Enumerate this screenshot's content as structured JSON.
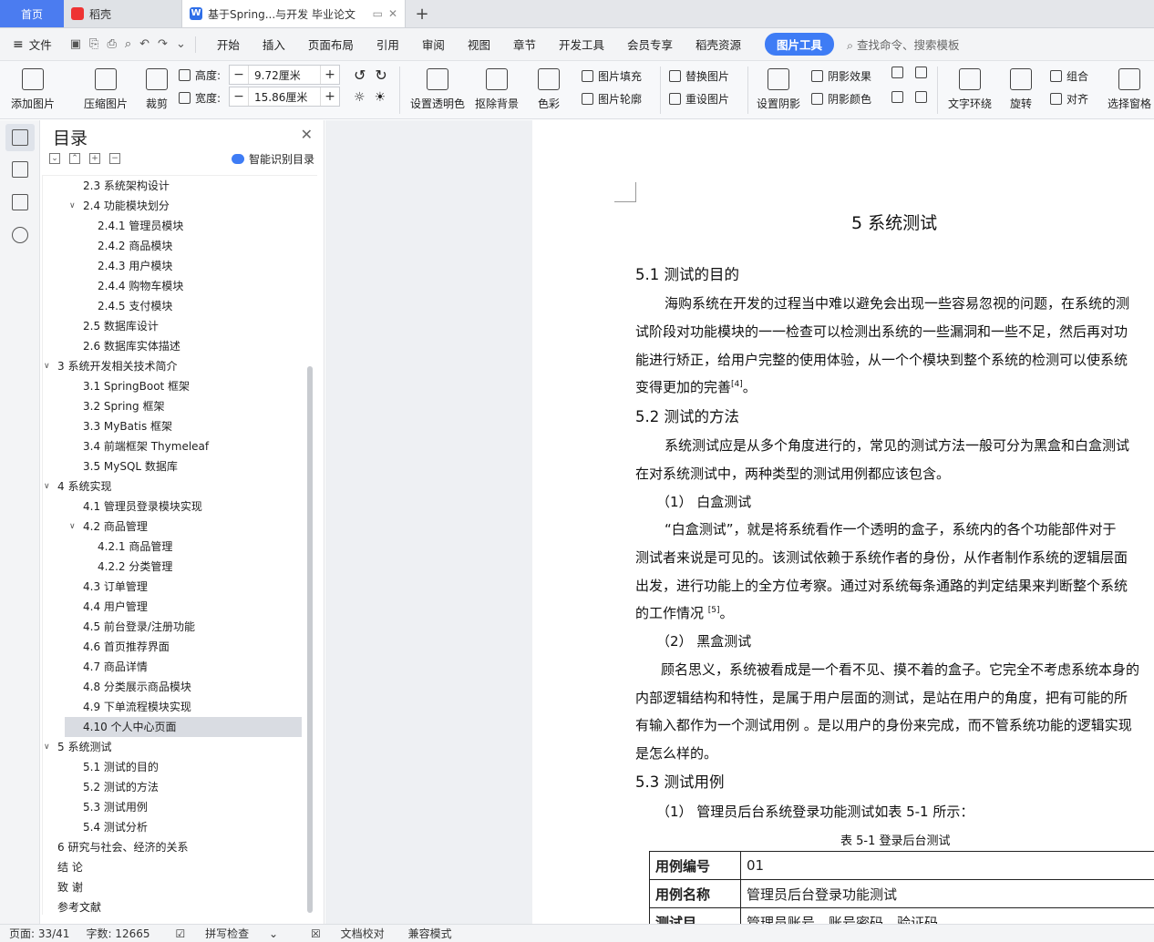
{
  "tabs": {
    "home": "首页",
    "docke": "稻壳",
    "doc": "基于Spring...与开发 毕业论文"
  },
  "menu": {
    "file": "文件",
    "items": [
      "开始",
      "插入",
      "页面布局",
      "引用",
      "审阅",
      "视图",
      "章节",
      "开发工具",
      "会员专享",
      "稻壳资源"
    ],
    "active": "图片工具",
    "search": "查找命令、搜索模板"
  },
  "ribbon": {
    "add_image": "添加图片",
    "compress": "压缩图片",
    "crop": "裁剪",
    "height_label": "高度:",
    "height_value": "9.72厘米",
    "width_label": "宽度:",
    "width_value": "15.86厘米",
    "transparency": "设置透明色",
    "remove_bg": "抠除背景",
    "color": "色彩",
    "fill": "图片填充",
    "outline": "图片轮廓",
    "replace": "替换图片",
    "reset": "重设图片",
    "shadow": "设置阴影",
    "shadow_effect": "阴影效果",
    "shadow_color": "阴影颜色",
    "wrap": "文字环绕",
    "rotate": "旋转",
    "group": "组合",
    "align": "对齐",
    "select_pane": "选择窗格"
  },
  "toc": {
    "title": "目录",
    "smart": "智能识别目录",
    "items": [
      {
        "text": "2.3  系统架构设计",
        "level": 2
      },
      {
        "text": "2.4  功能模块划分",
        "level": 2,
        "expanded": true
      },
      {
        "text": "2.4.1  管理员模块",
        "level": 3
      },
      {
        "text": "2.4.2  商品模块",
        "level": 3
      },
      {
        "text": "2.4.3  用户模块",
        "level": 3
      },
      {
        "text": "2.4.4  购物车模块",
        "level": 3
      },
      {
        "text": "2.4.5  支付模块",
        "level": 3
      },
      {
        "text": "2.5  数据库设计",
        "level": 2
      },
      {
        "text": "2.6  数据库实体描述",
        "level": 2
      },
      {
        "text": "3  系统开发相关技术简介",
        "level": 1,
        "expanded": true
      },
      {
        "text": "3.1 SpringBoot 框架",
        "level": 2
      },
      {
        "text": "3.2 Spring 框架",
        "level": 2
      },
      {
        "text": "3.3 MyBatis 框架",
        "level": 2
      },
      {
        "text": "3.4  前端框架 Thymeleaf",
        "level": 2
      },
      {
        "text": "3.5 MySQL 数据库",
        "level": 2
      },
      {
        "text": "4  系统实现",
        "level": 1,
        "expanded": true
      },
      {
        "text": "4.1  管理员登录模块实现",
        "level": 2
      },
      {
        "text": "4.2  商品管理",
        "level": 2,
        "expanded": true
      },
      {
        "text": "4.2.1  商品管理",
        "level": 3
      },
      {
        "text": "4.2.2  分类管理",
        "level": 3
      },
      {
        "text": "4.3  订单管理",
        "level": 2
      },
      {
        "text": "4.4  用户管理",
        "level": 2
      },
      {
        "text": "4.5  前台登录/注册功能",
        "level": 2
      },
      {
        "text": "4.6  首页推荐界面",
        "level": 2
      },
      {
        "text": "4.7  商品详情",
        "level": 2
      },
      {
        "text": "4.8  分类展示商品模块",
        "level": 2
      },
      {
        "text": "4.9  下单流程模块实现",
        "level": 2
      },
      {
        "text": "4.10  个人中心页面",
        "level": 2,
        "selected": true
      },
      {
        "text": "5  系统测试",
        "level": 1,
        "expanded": true
      },
      {
        "text": "5.1  测试的目的",
        "level": 2
      },
      {
        "text": "5.2  测试的方法",
        "level": 2
      },
      {
        "text": "5.3  测试用例",
        "level": 2
      },
      {
        "text": "5.4  测试分析",
        "level": 2
      },
      {
        "text": "6  研究与社会、经济的关系",
        "level": 1
      },
      {
        "text": "结  论",
        "level": 1
      },
      {
        "text": "致  谢",
        "level": 1
      },
      {
        "text": "参考文献",
        "level": 1
      }
    ]
  },
  "doc": {
    "h1": "5  系统测试",
    "s51": "5.1  测试的目的",
    "p1": "海购系统在开发的过程当中难以避免会出现一些容易忽视的问题，在系统的测",
    "p2": "试阶段对功能模块的一一检查可以检测出系统的一些漏洞和一些不足，然后再对功",
    "p3": "能进行矫正，给用户完整的使用体验，从一个个模块到整个系统的检测可以使系统",
    "p4": "变得更加的完善",
    "ref1": "[4]",
    "p4_end": "。",
    "s52": "5.2  测试的方法",
    "p5": "系统测试应是从多个角度进行的，常见的测试方法一般可分为黑盒和白盒测试",
    "p6": "在对系统测试中，两种类型的测试用例都应该包含。",
    "wb": "（1）  白盒测试",
    "p7": "“白盒测试”，就是将系统看作一个透明的盒子，系统内的各个功能部件对于",
    "p8": "测试者来说是可见的。该测试依赖于系统作者的身份，从作者制作系统的逻辑层面",
    "p9": "出发，进行功能上的全方位考察。通过对系统每条通路的判定结果来判断整个系统",
    "p10": "的工作情况 ",
    "ref2": "[5]",
    "p10_end": "。",
    "bb": "（2）  黑盒测试",
    "p11": "顾名思义，系统被看成是一个看不见、摸不着的盒子。它完全不考虑系统本身的",
    "p12": "内部逻辑结构和特性，是属于用户层面的测试，是站在用户的角度，把有可能的所",
    "p13": "有输入都作为一个测试用例 。是以用户的身份来完成，而不管系统功能的逻辑实现",
    "p14": "是怎么样的。",
    "s53": "5.3  测试用例",
    "p15": "（1）  管理员后台系统登录功能测试如表 5-1 所示：",
    "caption": "表 5-1  登录后台测试",
    "table": [
      {
        "k": "用例编号",
        "v": "01"
      },
      {
        "k": "用例名称",
        "v": "管理员后台登录功能测试"
      },
      {
        "k": "测试目",
        "v": "管理员账号、账号密码、验证码"
      }
    ]
  },
  "status": {
    "page": "页面: 33/41",
    "words": "字数: 12665",
    "spell": "拼写检查",
    "proof": "文档校对",
    "compat": "兼容模式"
  }
}
